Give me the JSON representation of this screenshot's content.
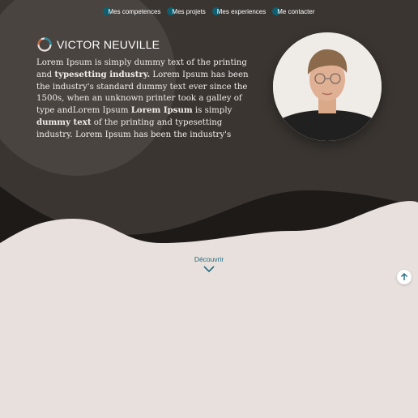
{
  "nav": {
    "items": [
      {
        "label": "Mes competences"
      },
      {
        "label": "Mes projets"
      },
      {
        "label": "Mes experiences"
      },
      {
        "label": "Me contacter"
      }
    ]
  },
  "brand": {
    "name": "VICTOR NEUVILLE",
    "logo_icon": "ring-logo-icon"
  },
  "intro": {
    "p1": "Lorem Ipsum is simply dummy text of the printing and ",
    "b1": "typesetting industry.",
    "p2": " Lorem Ipsum has been the industry's standard dummy text ever since the 1500s, when an unknown printer took a galley of type andLorem Ipsum ",
    "b2": "Lorem Ipsum",
    "p3": " is simply ",
    "b3": "dummy text",
    "p4": " of the printing and typesetting industry. Lorem Ipsum has been the industry's"
  },
  "cta": {
    "discover_label": "Découvrir"
  },
  "colors": {
    "hero_dark": "#3a3531",
    "hero_darker": "#1e1a18",
    "page_bg": "#e8e0dc",
    "accent": "#1f6b80",
    "nav_dot": "#0f5f70"
  },
  "icons": {
    "discover": "chevron-down-icon",
    "back_to_top": "arrow-up-icon"
  }
}
